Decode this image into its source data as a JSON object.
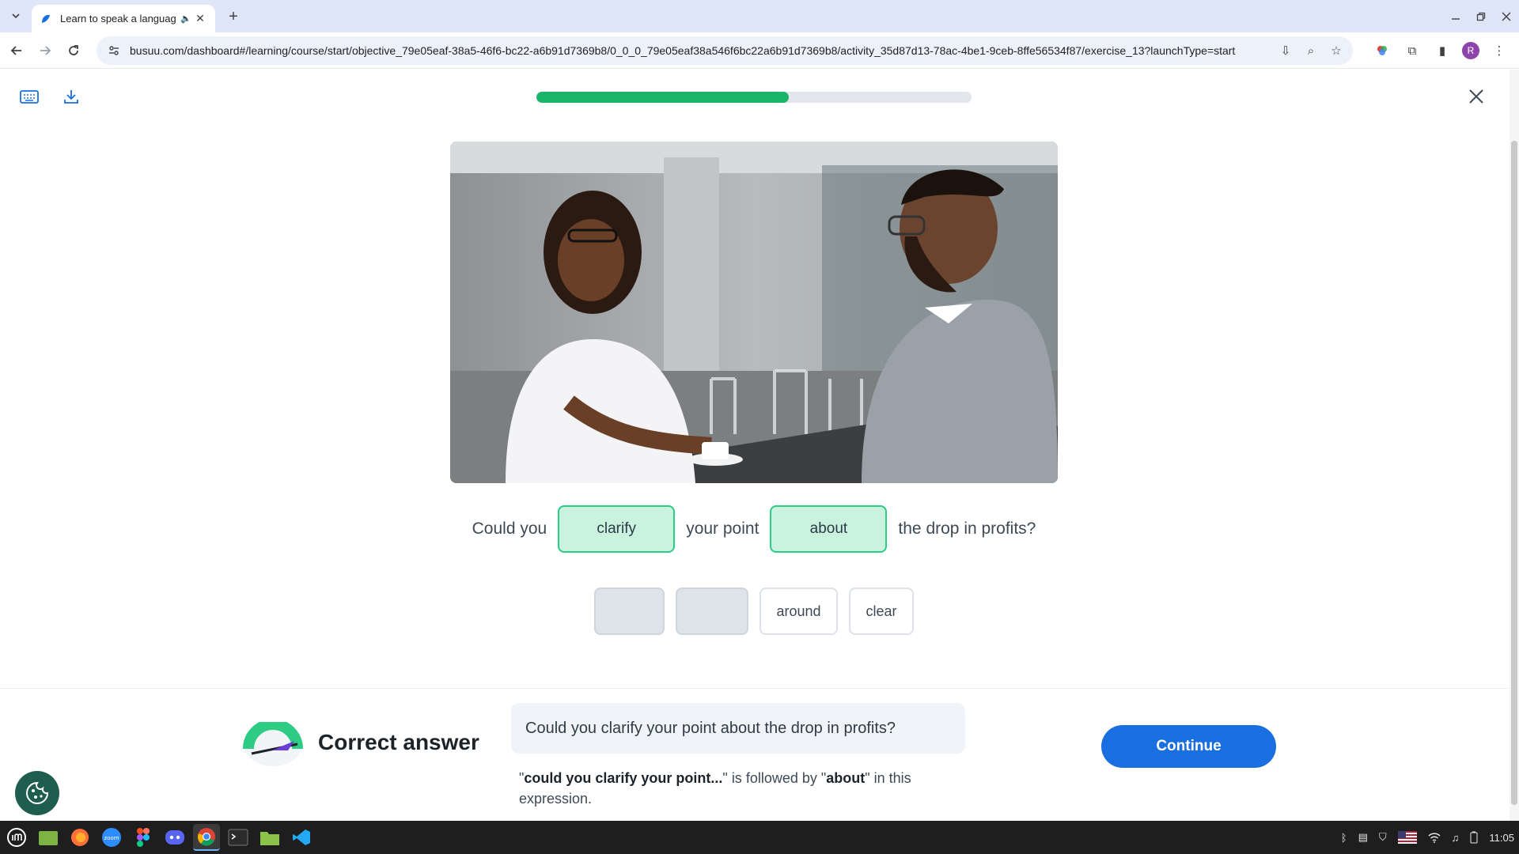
{
  "browser": {
    "tab_title": "Learn to speak a languag",
    "url": "busuu.com/dashboard#/learning/course/start/objective_79e05eaf-38a5-46f6-bc22-a6b91d7369b8/0_0_0_79e05eaf38a546f6bc22a6b91d7369b8/activity_35d87d13-78ac-4be1-9ceb-8ffe56534f87/exercise_13?launchType=start",
    "profile_initial": "R"
  },
  "lesson": {
    "progress_percent": 58,
    "sentence": {
      "part1": "Could you",
      "gap1": "clarify",
      "part2": "your point",
      "gap2": "about",
      "part3": "the drop in profits?"
    },
    "options": [
      {
        "label": "around"
      },
      {
        "label": "clear"
      }
    ]
  },
  "feedback": {
    "title": "Correct answer",
    "answer": "Could you clarify your point about the drop in profits?",
    "explain_q1": "\"",
    "explain_bold1": "could you clarify your point...",
    "explain_mid": "\" is followed by \"",
    "explain_bold2": "about",
    "explain_end": "\" in this expression.",
    "continue_label": "Continue"
  },
  "taskbar": {
    "clock": "11:05",
    "zoom_label": "zoom"
  },
  "colors": {
    "accent_blue": "#1a6fe0",
    "progress_green": "#1bb56a",
    "correct_fill": "#c9f2df",
    "correct_border": "#2dcb83"
  }
}
